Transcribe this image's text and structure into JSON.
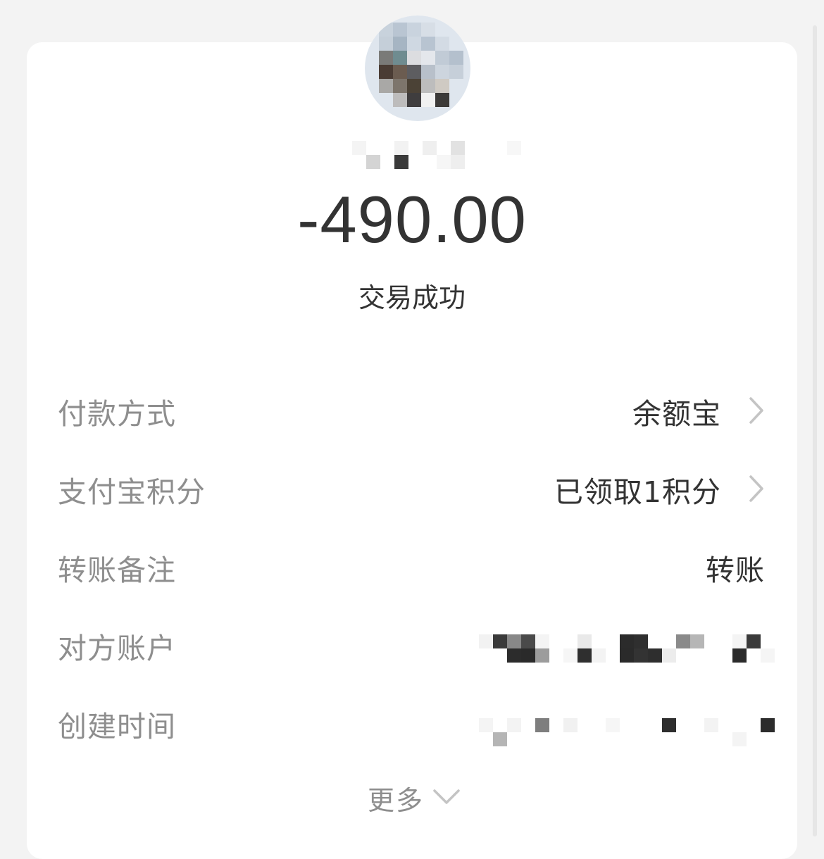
{
  "transaction": {
    "amount": "-490.00",
    "status": "交易成功"
  },
  "details": [
    {
      "label": "付款方式",
      "value": "余额宝",
      "has_arrow": true
    },
    {
      "label": "支付宝积分",
      "value": "已领取1积分",
      "has_arrow": true
    },
    {
      "label": "转账备注",
      "value": "转账",
      "has_arrow": false
    },
    {
      "label": "对方账户",
      "value": "",
      "redacted": true
    },
    {
      "label": "创建时间",
      "value": "",
      "redacted": true
    }
  ],
  "more": {
    "label": "更多"
  },
  "icons": {
    "arrow": "chevron-right-icon",
    "more": "chevron-down-icon"
  },
  "colors": {
    "background": "#f3f3f3",
    "card": "#ffffff",
    "text_primary": "#333333",
    "text_secondary": "#8e8e8e",
    "arrow": "#c4c4c4"
  }
}
